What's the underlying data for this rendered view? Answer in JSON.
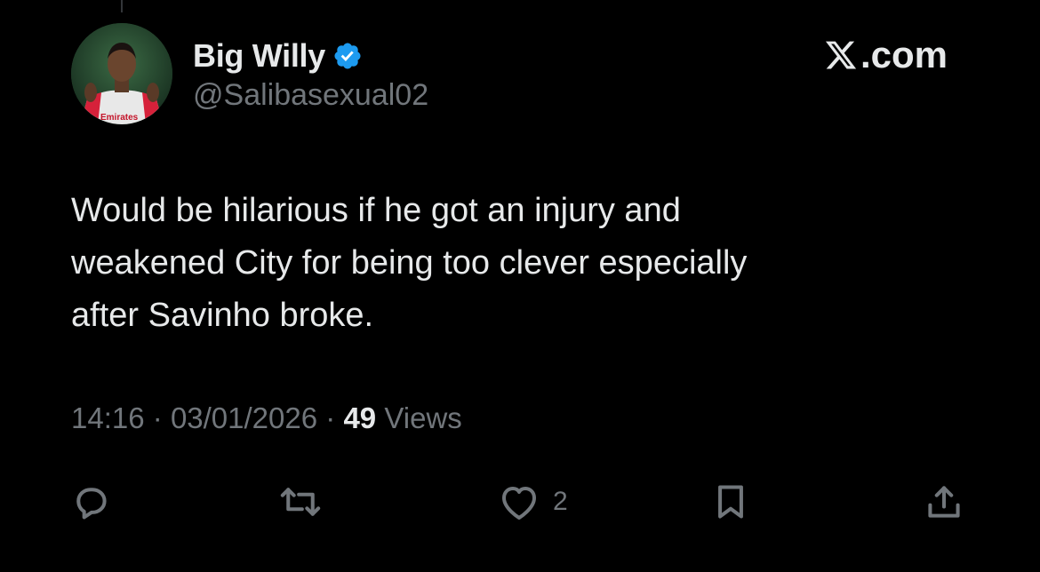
{
  "tweet": {
    "display_name": "Big Willy",
    "handle": "@Salibasexual02",
    "verified_color": "#1d9bf0",
    "text_lines": [
      "Would be hilarious if he got an injury and",
      "weakened City for being too clever especially",
      "after Savinho broke."
    ],
    "time": "14:16",
    "separator": "·",
    "date": "03/01/2026",
    "views_count": "49",
    "views_label": "Views"
  },
  "brand": {
    "site_text": ".com"
  },
  "actions": {
    "reply_icon": "reply-icon",
    "retweet_icon": "retweet-icon",
    "like_icon": "heart-icon",
    "like_count": "2",
    "bookmark_icon": "bookmark-icon",
    "share_icon": "share-icon"
  },
  "avatar_logo_text": "Emirates",
  "colors": {
    "background": "#000000",
    "primary_text": "#e7e9ea",
    "secondary_text": "#71767b"
  }
}
